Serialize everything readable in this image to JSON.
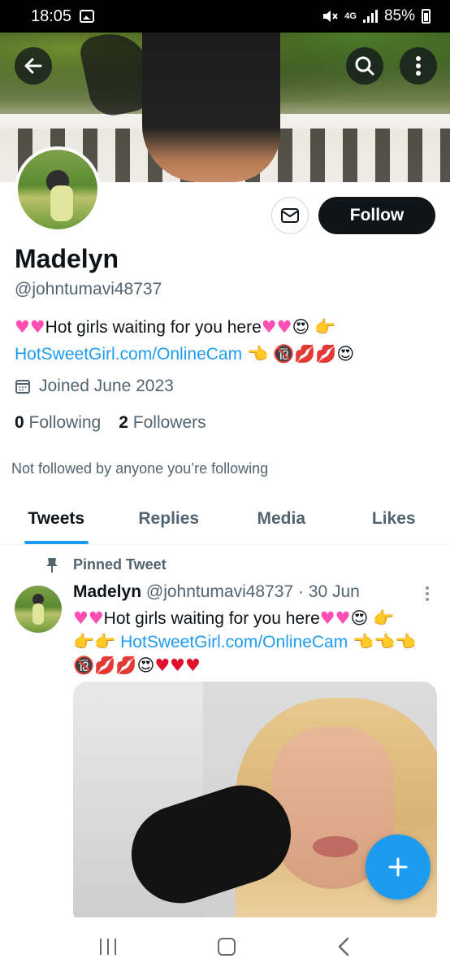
{
  "status_bar": {
    "time": "18:05",
    "network": "4G",
    "battery": "85%"
  },
  "profile": {
    "name": "Madelyn",
    "handle": "@johntumavi48737",
    "bio_line1_text": "Hot girls waiting for you here",
    "bio_link": "HotSweetGirl.com/OnlineCam",
    "joined": "Joined June 2023",
    "following_count": "0",
    "following_label": "Following",
    "followers_count": "2",
    "followers_label": "Followers",
    "not_followed_text": "Not followed by anyone you’re following"
  },
  "actions": {
    "follow_label": "Follow"
  },
  "tabs": [
    {
      "label": "Tweets",
      "active": true
    },
    {
      "label": "Replies",
      "active": false
    },
    {
      "label": "Media",
      "active": false
    },
    {
      "label": "Likes",
      "active": false
    }
  ],
  "tweet": {
    "pinned_label": "Pinned Tweet",
    "author": "Madelyn",
    "meta": "@johntumavi48737 · 30 Jun",
    "text_line1": "Hot girls waiting for you here",
    "link": "HotSweetGirl.com/OnlineCam"
  },
  "colors": {
    "accent": "#1d9bf0",
    "text_primary": "#0f1419",
    "text_secondary": "#536471",
    "follow_bg": "#0f1419"
  }
}
